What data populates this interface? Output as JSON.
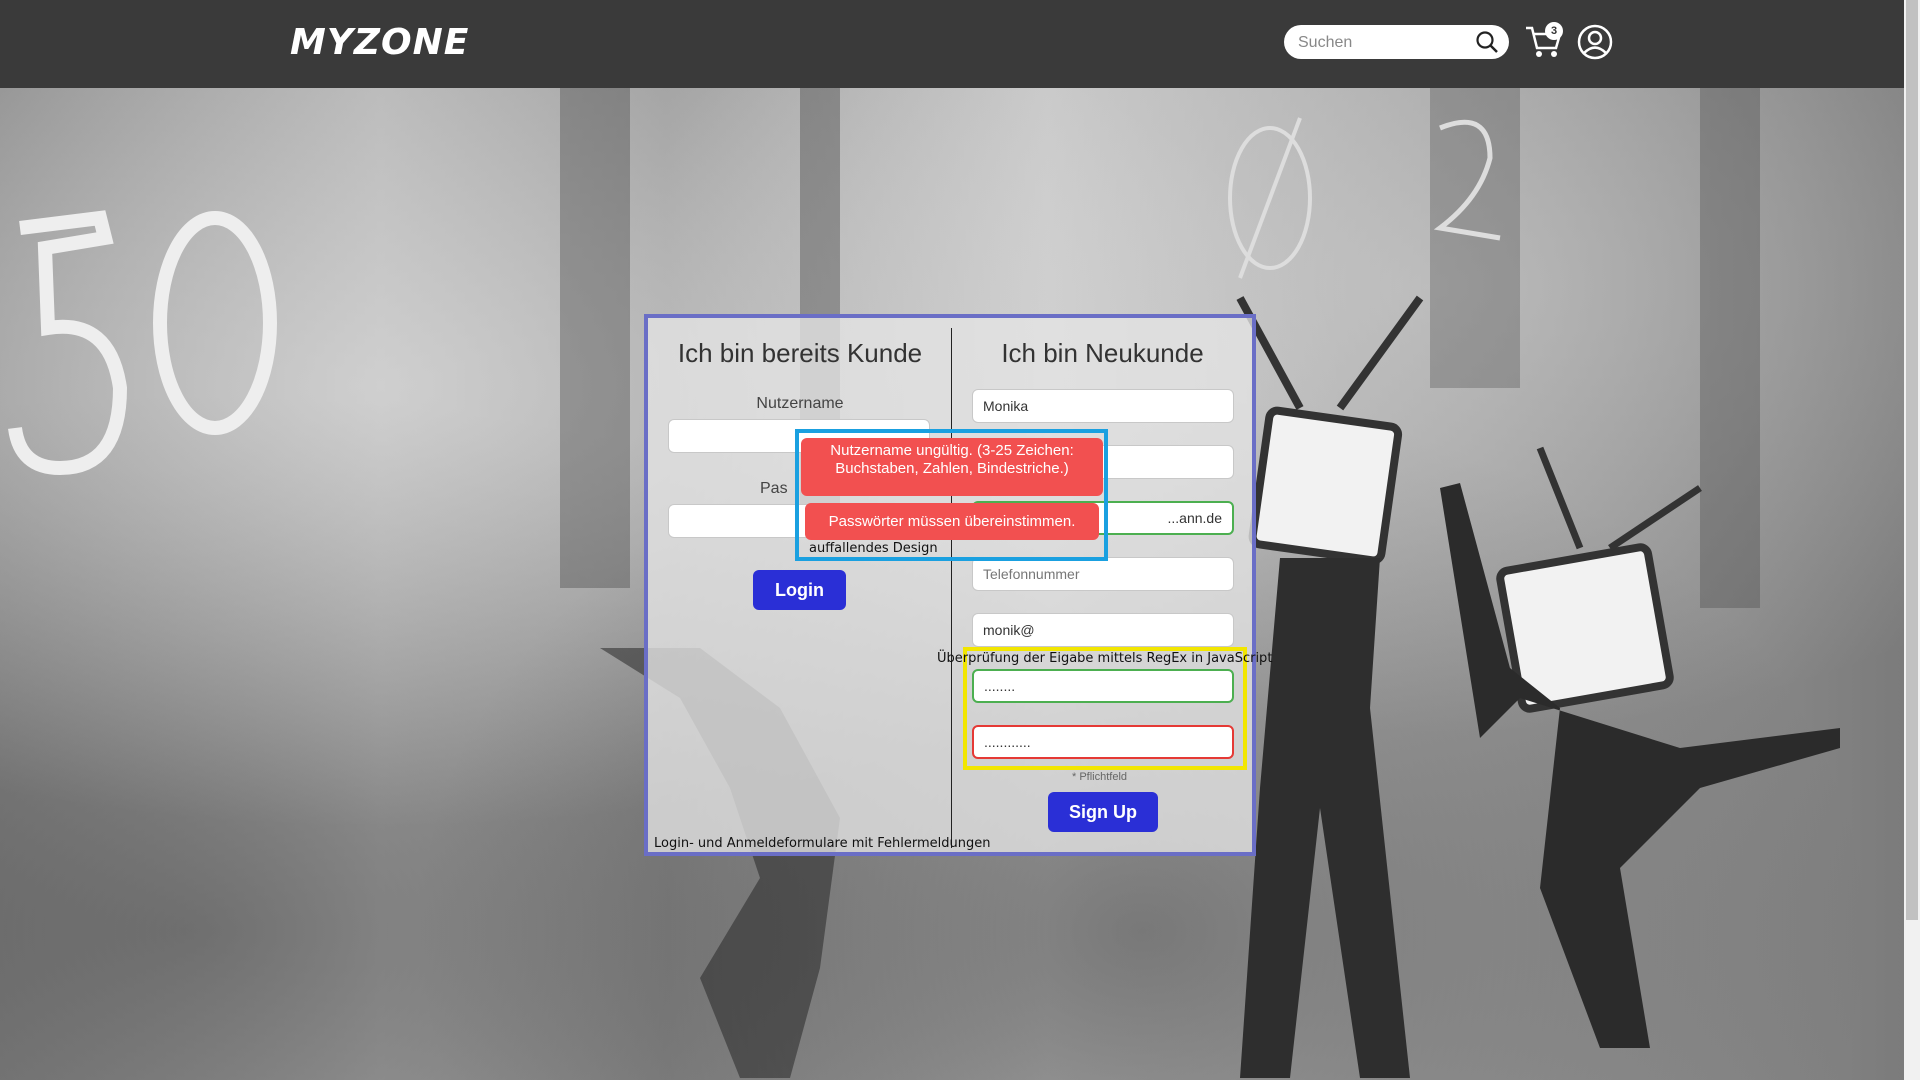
{
  "header": {
    "logo": "MYZONE",
    "search_placeholder": "Suchen",
    "cart_count": "3"
  },
  "login": {
    "title": "Ich bin bereits Kunde",
    "username_label": "Nutzername",
    "password_label": "Pas",
    "button": "Login"
  },
  "signup": {
    "title": "Ich bin Neukunde",
    "first_name_value": "Monika",
    "email_value": "...ann.de",
    "phone_placeholder": "Telefonnummer",
    "username_value": "monik@",
    "password_value": "........",
    "password_confirm_value": "............",
    "required_note": "* Pflichtfeld",
    "button": "Sign Up"
  },
  "errors": {
    "username": "Nutzername ungültig. (3-25 Zeichen: Buchstaben, Zahlen, Bindestriche.)",
    "password": "Passwörter müssen übereinstimmen."
  },
  "annotations": {
    "design": "auffallendes Design",
    "regex": "Überprüfung der Eigabe mittels RegEx in JavaScript",
    "forms": "Login- und Anmeldeformulare mit Fehlermeldungen"
  }
}
